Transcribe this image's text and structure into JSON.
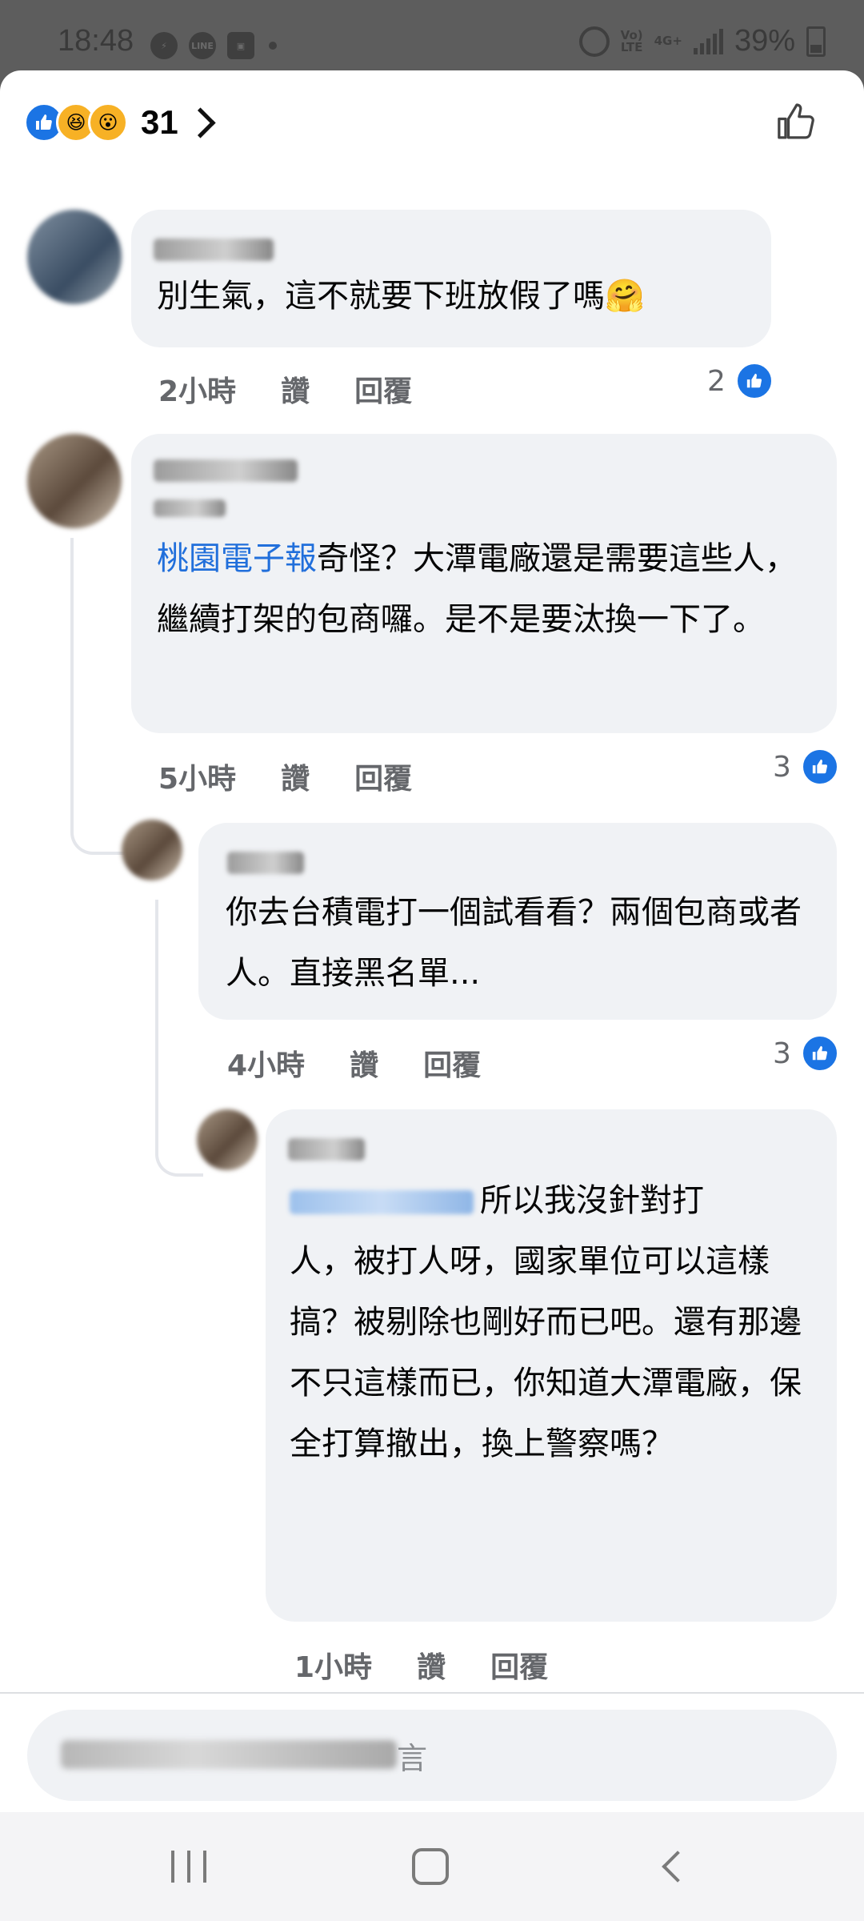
{
  "status": {
    "time": "18:48",
    "net_top": "Vo)",
    "net_bottom": "LTE",
    "net_type": "4G+",
    "battery": "39%"
  },
  "reactions": {
    "count": "31",
    "icons": [
      "like-icon",
      "haha-icon",
      "wow-icon"
    ]
  },
  "comments": [
    {
      "text": "別生氣，這不就要下班放假了嗎🤗",
      "time": "2小時",
      "like_label": "讚",
      "reply_label": "回覆",
      "likes": "2"
    },
    {
      "mention": "桃園電子報",
      "text": "奇怪？大潭電廠還是需要這些人，繼續打架的包商囉。是不是要汰換一下了。",
      "time": "5小時",
      "like_label": "讚",
      "reply_label": "回覆",
      "likes": "3"
    },
    {
      "text": "你去台積電打一個試看看？兩個包商或者人。直接黑名單...",
      "time": "4小時",
      "like_label": "讚",
      "reply_label": "回覆",
      "likes": "3"
    },
    {
      "text_line1": "所以我沒針對打",
      "text_rest": "人，被打人呀，國家單位可以這樣搞？被剔除也剛好而已吧。還有那邊不只這樣而已，你知道大潭電廠，保全打算撤出，換上警察嗎？",
      "time": "1小時",
      "like_label": "讚",
      "reply_label": "回覆"
    }
  ],
  "composer": {
    "placeholder_tail": "言"
  },
  "colors": {
    "accent": "#1b74e4",
    "mention": "#216fdb",
    "bubble": "#f0f2f5",
    "meta": "#65676b"
  }
}
